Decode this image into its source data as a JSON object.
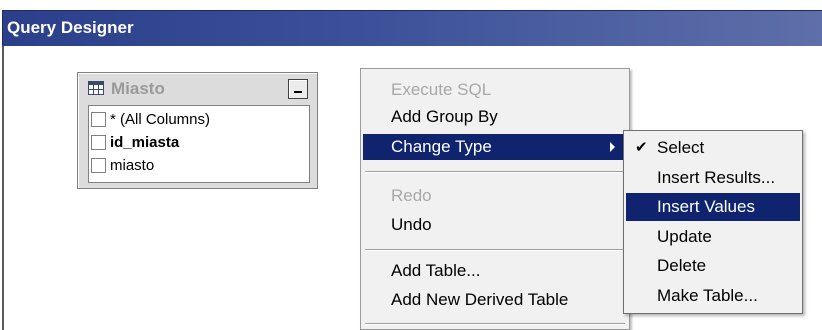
{
  "window": {
    "title": "Query Designer"
  },
  "table": {
    "name": "Miasto",
    "columns": [
      {
        "label": "* (All Columns)",
        "bold": false,
        "checked": false
      },
      {
        "label": "id_miasta",
        "bold": true,
        "checked": false
      },
      {
        "label": "miasto",
        "bold": false,
        "checked": false
      }
    ]
  },
  "context_menu": {
    "items": [
      {
        "label": "Execute SQL",
        "disabled": true
      },
      {
        "label": "Add Group By",
        "disabled": false
      },
      {
        "label": "Change Type",
        "disabled": false,
        "highlighted": true,
        "has_submenu": true
      },
      {
        "label": "Redo",
        "disabled": true
      },
      {
        "label": "Undo",
        "disabled": false
      },
      {
        "label": "Add Table...",
        "disabled": false
      },
      {
        "label": "Add New Derived Table",
        "disabled": false
      }
    ]
  },
  "submenu": {
    "items": [
      {
        "label": "Select",
        "checked": true
      },
      {
        "label": "Insert Results...",
        "checked": false
      },
      {
        "label": "Insert Values",
        "checked": false,
        "highlighted": true
      },
      {
        "label": "Update",
        "checked": false
      },
      {
        "label": "Delete",
        "checked": false
      },
      {
        "label": "Make Table...",
        "checked": false
      }
    ]
  },
  "colors": {
    "title_bar": "#2b3f8a",
    "highlight": "#0f236f",
    "menu_bg": "#f1f1f1",
    "disabled_text": "#a8a8a8"
  },
  "icons": {
    "table": "table-grid-icon",
    "collapse": "minus-icon",
    "submenu_arrow": "chevron-right-icon",
    "check": "check-icon"
  }
}
